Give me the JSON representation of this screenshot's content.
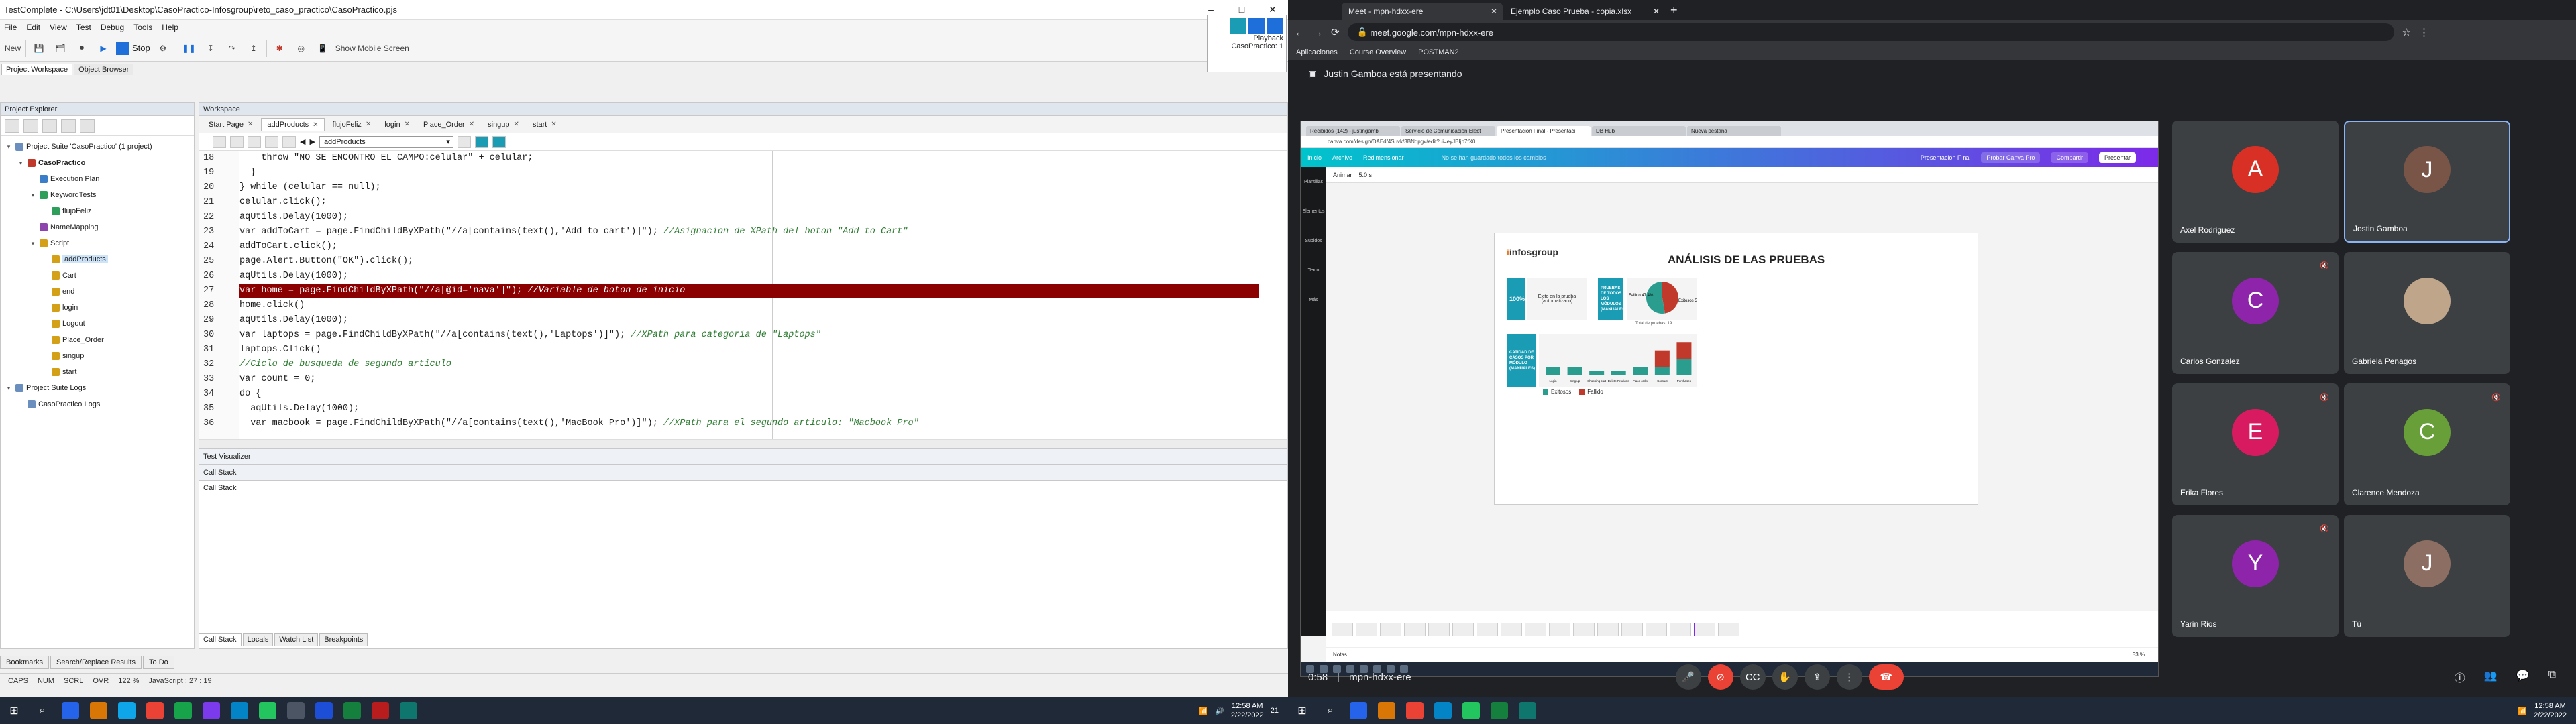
{
  "tc": {
    "title": "TestComplete - C:\\Users\\jdt01\\Desktop\\CasoPractico-Infosgroup\\reto_caso_practico\\CasoPractico.pjs",
    "menu": [
      "File",
      "Edit",
      "View",
      "Test",
      "Debug",
      "Tools",
      "Help"
    ],
    "toolbar": {
      "new_label": "New",
      "stop_label": "Stop",
      "mobile_label": "Show Mobile Screen"
    },
    "playback": {
      "label": "Playback",
      "project": "CasoPractico: 1"
    },
    "top_tabs": [
      "Project Workspace",
      "Object Browser"
    ],
    "explorer_title": "Project Explorer",
    "tree": [
      {
        "label": "Project Suite 'CasoPractico' (1 project)",
        "level": 0,
        "toggle": "▾",
        "color": "#6a8fbf"
      },
      {
        "label": "CasoPractico",
        "level": 1,
        "toggle": "▾",
        "color": "#c0392b",
        "bold": true
      },
      {
        "label": "Execution Plan",
        "level": 2,
        "toggle": "",
        "color": "#3a7dc8"
      },
      {
        "label": "KeywordTests",
        "level": 2,
        "toggle": "▾",
        "color": "#2e9e5b"
      },
      {
        "label": "flujoFeliz",
        "level": 3,
        "toggle": "",
        "color": "#2e9e5b"
      },
      {
        "label": "NameMapping",
        "level": 2,
        "toggle": "",
        "color": "#8e44ad"
      },
      {
        "label": "Script",
        "level": 2,
        "toggle": "▾",
        "color": "#d4a017"
      },
      {
        "label": "addProducts",
        "level": 3,
        "toggle": "",
        "color": "#d4a017",
        "sel": true
      },
      {
        "label": "Cart",
        "level": 3,
        "toggle": "",
        "color": "#d4a017"
      },
      {
        "label": "end",
        "level": 3,
        "toggle": "",
        "color": "#d4a017"
      },
      {
        "label": "login",
        "level": 3,
        "toggle": "",
        "color": "#d4a017"
      },
      {
        "label": "Logout",
        "level": 3,
        "toggle": "",
        "color": "#d4a017"
      },
      {
        "label": "Place_Order",
        "level": 3,
        "toggle": "",
        "color": "#d4a017"
      },
      {
        "label": "singup",
        "level": 3,
        "toggle": "",
        "color": "#d4a017"
      },
      {
        "label": "start",
        "level": 3,
        "toggle": "",
        "color": "#d4a017"
      },
      {
        "label": "Project Suite Logs",
        "level": 0,
        "toggle": "▾",
        "color": "#6a8fbf"
      },
      {
        "label": "CasoPractico Logs",
        "level": 1,
        "toggle": "",
        "color": "#6a8fbf"
      }
    ],
    "workspace_title": "Workspace",
    "ws_tabs": [
      "Start Page",
      "addProducts",
      "flujoFeliz",
      "login",
      "Place_Order",
      "singup",
      "start"
    ],
    "routine": "addProducts",
    "code": [
      {
        "n": "18",
        "t": "    throw \"NO SE ENCONTRO EL CAMPO:celular\" + celular;",
        "c": ""
      },
      {
        "n": "19",
        "t": "  }",
        "c": ""
      },
      {
        "n": "20",
        "t": "} while (celular == null);",
        "c": ""
      },
      {
        "n": "21",
        "t": "celular.click();",
        "c": ""
      },
      {
        "n": "22",
        "t": "aqUtils.Delay(1000);",
        "c": ""
      },
      {
        "n": "23",
        "t": "var addToCart = page.FindChildByXPath(\"//a[contains(text(),'Add to cart')]\");",
        "c": " //Asignacion de XPath del boton \"Add to Cart\""
      },
      {
        "n": "24",
        "t": "addToCart.click();",
        "c": ""
      },
      {
        "n": "25",
        "t": "page.Alert.Button(\"OK\").click();",
        "c": ""
      },
      {
        "n": "26",
        "t": "aqUtils.Delay(1000);",
        "c": ""
      },
      {
        "n": "27",
        "t": "var home = page.FindChildByXPath(\"//a[@id='nava']\");",
        "c": " //Variable de boton de inicio",
        "hl": true
      },
      {
        "n": "28",
        "t": "home.click()",
        "c": ""
      },
      {
        "n": "29",
        "t": "aqUtils.Delay(1000);",
        "c": ""
      },
      {
        "n": "30",
        "t": "var laptops = page.FindChildByXPath(\"//a[contains(text(),'Laptops')]\");",
        "c": " //XPath para categoria de \"Laptops\""
      },
      {
        "n": "31",
        "t": "laptops.Click()",
        "c": ""
      },
      {
        "n": "32",
        "t": "",
        "c": "//Ciclo de busqueda de segundo articulo"
      },
      {
        "n": "33",
        "t": "var count = 0;",
        "c": ""
      },
      {
        "n": "34",
        "t": "do {",
        "c": ""
      },
      {
        "n": "35",
        "t": "  aqUtils.Delay(1000);",
        "c": ""
      },
      {
        "n": "36",
        "t": "  var macbook = page.FindChildByXPath(\"//a[contains(text(),'MacBook Pro')]\");",
        "c": " //XPath para el segundo articulo: \"Macbook Pro\""
      }
    ],
    "test_visualizer": "Test Visualizer",
    "call_stack": "Call Stack",
    "call_stack_col": "Call Stack",
    "bottom_tabs": [
      "Call Stack",
      "Locals",
      "Watch List",
      "Breakpoints"
    ],
    "left_bottom_tabs": [
      "Bookmarks",
      "Search/Replace Results",
      "To Do"
    ],
    "status": [
      "CAPS",
      "NUM",
      "SCRL",
      "OVR",
      "122 %",
      "JavaScript : 27 : 19"
    ]
  },
  "chrome": {
    "tabs": [
      "Meet - mpn-hdxx-ere",
      "Ejemplo Caso Prueba - copia.xlsx"
    ],
    "url": "meet.google.com/mpn-hdxx-ere",
    "bookmarks": [
      "Aplicaciones",
      "Course Overview",
      "POSTMAN2"
    ]
  },
  "meet": {
    "presenting": "Justin Gamboa está presentando",
    "time": "0:58",
    "code": "mpn-hdxx-ere",
    "participants": [
      {
        "name": "Axel Rodriguez",
        "initial": "A",
        "color": "#d93025"
      },
      {
        "name": "Jostin Gamboa",
        "initial": "J",
        "color": "#795548"
      },
      {
        "name": "Carlos Gonzalez",
        "initial": "C",
        "color": "#8e24aa"
      },
      {
        "name": "Gabriela Penagos",
        "initial": "",
        "color": "#bfa58a"
      },
      {
        "name": "Erika Flores",
        "initial": "E",
        "color": "#d81b60"
      },
      {
        "name": "Clarence Mendoza",
        "initial": "C",
        "color": "#689f38"
      },
      {
        "name": "Yarin Rios",
        "initial": "Y",
        "color": "#8e24aa"
      },
      {
        "name": "Tú",
        "initial": "J",
        "color": "#8d6e63"
      }
    ]
  },
  "canva": {
    "browser_tabs": [
      "Recibidos (142) - justingamb",
      "Servicio de Comunicación Elect",
      "Presentación Final - Presentaci",
      "DB Hub",
      "Nueva pestaña"
    ],
    "url": "canva.com/design/DAEd/4Suvk/3BNdpgv/edit?ui=eyJBIjp7fX0",
    "bar": [
      "Inicio",
      "Archivo",
      "Redimensionar"
    ],
    "saved": "No se han guardado todos los cambios",
    "title": "Presentación Final",
    "try": "Probar Canva Pro",
    "share": "Compartir",
    "present": "Presentar",
    "tb": [
      "Animar",
      "5.0 s"
    ],
    "side": [
      "Plantillas",
      "Elementos",
      "Subidos",
      "Texto",
      "Más"
    ],
    "slide_title": "ANÁLISIS DE LAS PRUEBAS",
    "logo_text": "infosgroup",
    "pct": "100%",
    "exito_label": "Éxito en la prueba (automatizado)",
    "pruebas_box": "PRUEBAS DE TODOS LOS MÓDULOS (MANUALES)",
    "pie_fail": "Fallido 47.4%",
    "pie_ok": "Exitosos 52.6%",
    "pie_caption": "Total de pruebas: 19",
    "casos_box": "CATIDAD DE CASOS POR MÓDULO (MANUALES)",
    "legend_ok": "Exitosos",
    "legend_fail": "Fallido",
    "notes": "Notas",
    "zoom": "53 %"
  },
  "chart_data": [
    {
      "type": "pie",
      "slices": [
        {
          "name": "Fallido",
          "value": 47.4
        },
        {
          "name": "Exitosos",
          "value": 52.6
        }
      ],
      "title": ""
    },
    {
      "type": "bar",
      "categories": [
        "Login",
        "Sing up",
        "Shopping cart",
        "Delete Products",
        "Place order",
        "Contact",
        "Purchases"
      ],
      "series": [
        {
          "name": "Exitosos",
          "values": [
            1,
            1,
            0.5,
            0.5,
            1,
            1,
            2
          ]
        },
        {
          "name": "Fallido",
          "values": [
            0,
            0,
            0,
            0,
            0,
            2,
            2
          ]
        }
      ],
      "title": ""
    }
  ],
  "colors": {
    "teal": "#1b9cb5",
    "ok": "#2a9d8f",
    "fail": "#c0392b",
    "hl": "#8b0000"
  },
  "taskbar": {
    "time": "12:58 AM",
    "date": "2/22/2022",
    "badge": "21"
  }
}
